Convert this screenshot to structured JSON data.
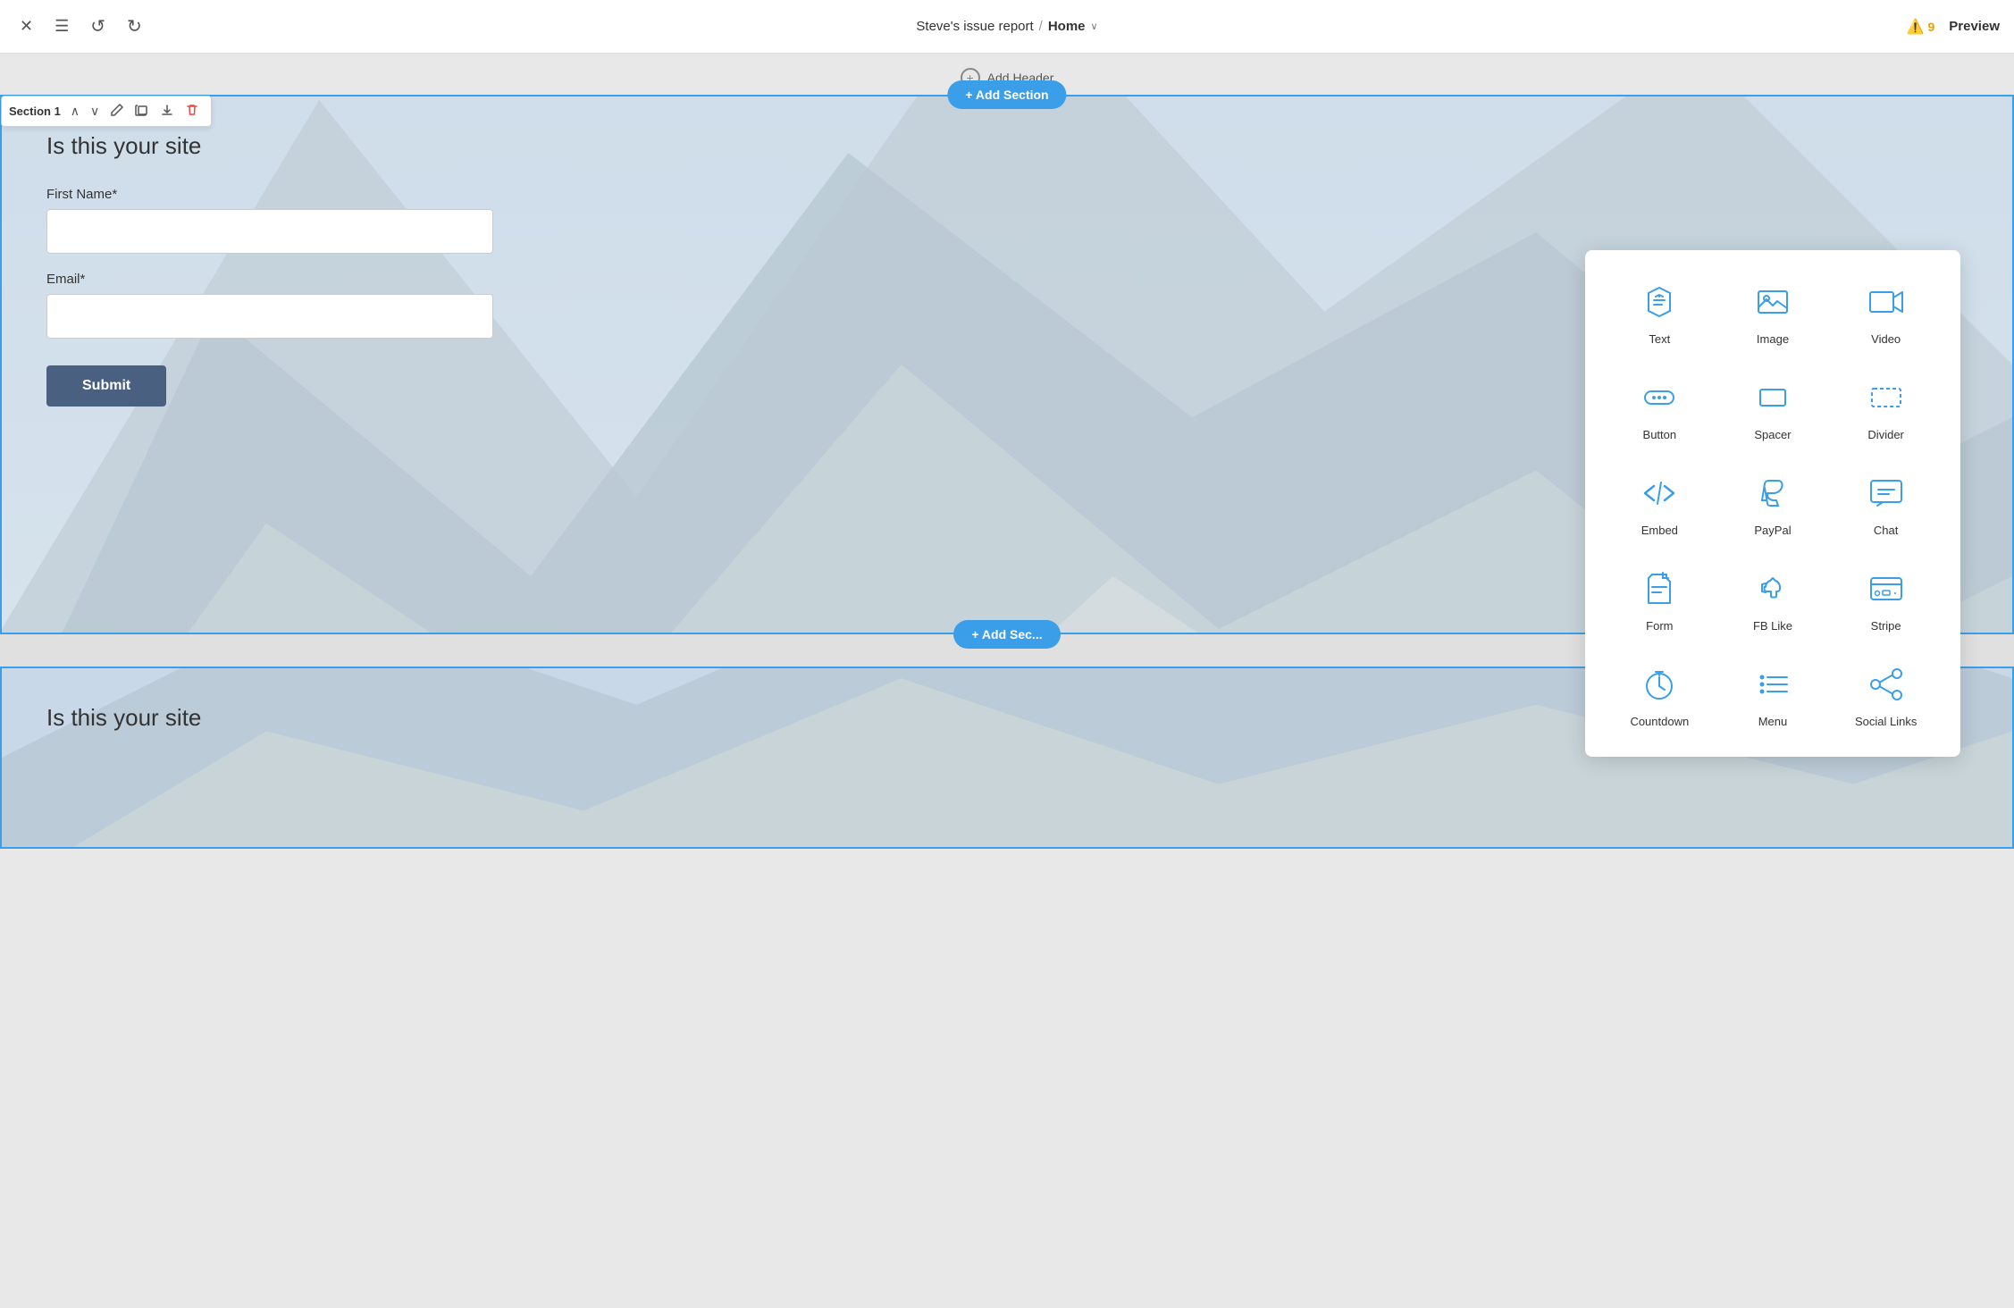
{
  "topbar": {
    "close_label": "✕",
    "menu_label": "☰",
    "undo_label": "↺",
    "redo_label": "↻",
    "site_name": "Steve's issue report",
    "slash": "/",
    "page_name": "Home",
    "chevron": "∨",
    "warning_icon": "⚠",
    "warning_count": "9",
    "preview_label": "Preview"
  },
  "canvas": {
    "add_header_label": "Add Header",
    "add_section_label": "+ Add Section",
    "add_section_bottom_label": "+ Add Sec..."
  },
  "section1": {
    "toolbar": {
      "label": "Section 1",
      "up": "∧",
      "down": "∨",
      "edit": "✎",
      "duplicate": "⧉",
      "download": "⬇",
      "delete": "🗑"
    },
    "title": "Is this your site",
    "first_name_label": "First Name*",
    "first_name_placeholder": "",
    "email_label": "Email*",
    "email_placeholder": "",
    "submit_label": "Submit"
  },
  "section2": {
    "title": "Is this your site"
  },
  "widget_panel": {
    "items": [
      {
        "id": "text",
        "label": "Text"
      },
      {
        "id": "image",
        "label": "Image"
      },
      {
        "id": "video",
        "label": "Video"
      },
      {
        "id": "button",
        "label": "Button"
      },
      {
        "id": "spacer",
        "label": "Spacer"
      },
      {
        "id": "divider",
        "label": "Divider"
      },
      {
        "id": "embed",
        "label": "Embed"
      },
      {
        "id": "paypal",
        "label": "PayPal"
      },
      {
        "id": "chat",
        "label": "Chat"
      },
      {
        "id": "form",
        "label": "Form"
      },
      {
        "id": "fblikes",
        "label": "FB Like"
      },
      {
        "id": "stripe",
        "label": "Stripe"
      },
      {
        "id": "countdown",
        "label": "Countdown"
      },
      {
        "id": "menu",
        "label": "Menu"
      },
      {
        "id": "sociallinks",
        "label": "Social Links"
      }
    ]
  }
}
